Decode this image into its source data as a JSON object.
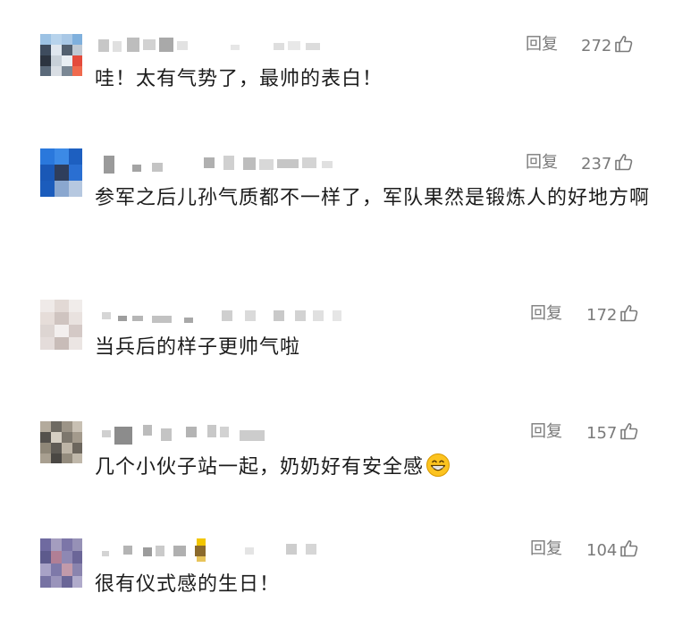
{
  "reply_label": "回复",
  "colors": {
    "text": "#1c1c1c",
    "meta": "#7a7a7a",
    "background": "#ffffff"
  },
  "comments": [
    {
      "likes": "272",
      "text": "哇！太有气势了，最帅的表白！",
      "avatar": "pixelated-avatar",
      "username": "pixelated-username"
    },
    {
      "likes": "237",
      "text": "参军之后儿孙气质都不一样了，军队果然是锻炼人的好地方啊",
      "avatar": "pixelated-avatar",
      "username": "pixelated-username"
    },
    {
      "likes": "172",
      "text": "当兵后的样子更帅气啦",
      "avatar": "pixelated-avatar",
      "username": "pixelated-username"
    },
    {
      "likes": "157",
      "text": "几个小伙子站一起，奶奶好有安全感",
      "emoji": "grinning-face-emoji",
      "avatar": "pixelated-avatar",
      "username": "pixelated-username"
    },
    {
      "likes": "104",
      "text": "很有仪式感的生日！",
      "avatar": "pixelated-avatar",
      "username": "pixelated-username"
    }
  ]
}
